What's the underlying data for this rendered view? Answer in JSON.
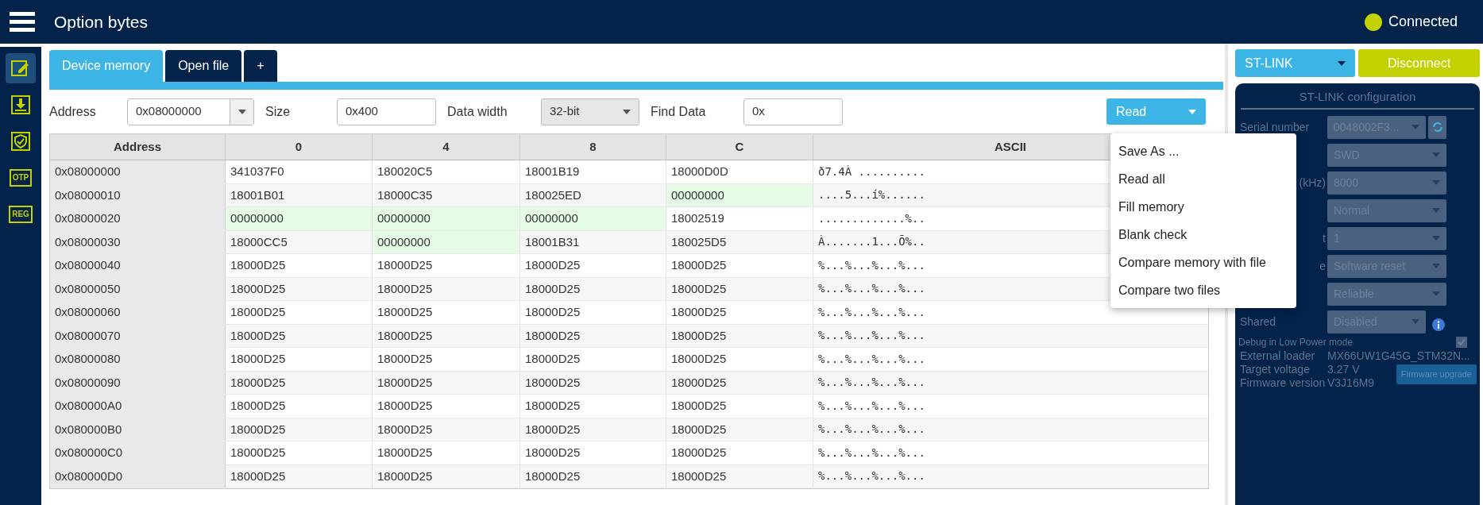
{
  "header": {
    "title": "Option bytes",
    "status": "Connected"
  },
  "sidebar": {
    "items": [
      {
        "kind": "edit",
        "selected": true
      },
      {
        "kind": "download",
        "selected": false
      },
      {
        "kind": "shield",
        "selected": false
      },
      {
        "kind": "text",
        "label": "OTP",
        "selected": false
      },
      {
        "kind": "text",
        "label": "REG",
        "selected": false
      }
    ]
  },
  "tabs": [
    {
      "label": "Device memory",
      "selected": true
    },
    {
      "label": "Open file",
      "selected": false
    },
    {
      "label": "+",
      "selected": false
    }
  ],
  "toolbar": {
    "address_label": "Address",
    "address": "0x08000000",
    "size_label": "Size",
    "size": "0x400",
    "width_label": "Data width",
    "width": "32-bit",
    "find_label": "Find Data",
    "find": "0x",
    "read_button": "Read"
  },
  "table": {
    "columns": [
      "Address",
      "0",
      "4",
      "8",
      "C",
      "ASCII"
    ],
    "rows": [
      {
        "address": "0x08000000",
        "cells": [
          {
            "value": "341037F0",
            "highlighted": false
          },
          {
            "value": "180020C5",
            "highlighted": false
          },
          {
            "value": "18001B19",
            "highlighted": false
          },
          {
            "value": "18000D0D",
            "highlighted": false
          }
        ],
        "ascii": "ð7.4À .........."
      },
      {
        "address": "0x08000010",
        "cells": [
          {
            "value": "18001B01",
            "highlighted": false
          },
          {
            "value": "18000C35",
            "highlighted": false
          },
          {
            "value": "180025ED",
            "highlighted": false
          },
          {
            "value": "00000000",
            "highlighted": true
          }
        ],
        "ascii": "....5...í%......"
      },
      {
        "address": "0x08000020",
        "cells": [
          {
            "value": "00000000",
            "highlighted": true
          },
          {
            "value": "00000000",
            "highlighted": true
          },
          {
            "value": "00000000",
            "highlighted": true
          },
          {
            "value": "18002519",
            "highlighted": false
          }
        ],
        "ascii": ".............%.."
      },
      {
        "address": "0x08000030",
        "cells": [
          {
            "value": "18000CC5",
            "highlighted": false
          },
          {
            "value": "00000000",
            "highlighted": true
          },
          {
            "value": "18001B31",
            "highlighted": false
          },
          {
            "value": "180025D5",
            "highlighted": false
          }
        ],
        "ascii": "À.......1...Õ%.."
      },
      {
        "address": "0x08000040",
        "cells": [
          {
            "value": "18000D25",
            "highlighted": false
          },
          {
            "value": "18000D25",
            "highlighted": false
          },
          {
            "value": "18000D25",
            "highlighted": false
          },
          {
            "value": "18000D25",
            "highlighted": false
          }
        ],
        "ascii": "%...%...%...%..."
      },
      {
        "address": "0x08000050",
        "cells": [
          {
            "value": "18000D25",
            "highlighted": false
          },
          {
            "value": "18000D25",
            "highlighted": false
          },
          {
            "value": "18000D25",
            "highlighted": false
          },
          {
            "value": "18000D25",
            "highlighted": false
          }
        ],
        "ascii": "%...%...%...%..."
      },
      {
        "address": "0x08000060",
        "cells": [
          {
            "value": "18000D25",
            "highlighted": false
          },
          {
            "value": "18000D25",
            "highlighted": false
          },
          {
            "value": "18000D25",
            "highlighted": false
          },
          {
            "value": "18000D25",
            "highlighted": false
          }
        ],
        "ascii": "%...%...%...%..."
      },
      {
        "address": "0x08000070",
        "cells": [
          {
            "value": "18000D25",
            "highlighted": false
          },
          {
            "value": "18000D25",
            "highlighted": false
          },
          {
            "value": "18000D25",
            "highlighted": false
          },
          {
            "value": "18000D25",
            "highlighted": false
          }
        ],
        "ascii": "%...%...%...%..."
      },
      {
        "address": "0x08000080",
        "cells": [
          {
            "value": "18000D25",
            "highlighted": false
          },
          {
            "value": "18000D25",
            "highlighted": false
          },
          {
            "value": "18000D25",
            "highlighted": false
          },
          {
            "value": "18000D25",
            "highlighted": false
          }
        ],
        "ascii": "%...%...%...%..."
      },
      {
        "address": "0x08000090",
        "cells": [
          {
            "value": "18000D25",
            "highlighted": false
          },
          {
            "value": "18000D25",
            "highlighted": false
          },
          {
            "value": "18000D25",
            "highlighted": false
          },
          {
            "value": "18000D25",
            "highlighted": false
          }
        ],
        "ascii": "%...%...%...%..."
      },
      {
        "address": "0x080000A0",
        "cells": [
          {
            "value": "18000D25",
            "highlighted": false
          },
          {
            "value": "18000D25",
            "highlighted": false
          },
          {
            "value": "18000D25",
            "highlighted": false
          },
          {
            "value": "18000D25",
            "highlighted": false
          }
        ],
        "ascii": "%...%...%...%..."
      },
      {
        "address": "0x080000B0",
        "cells": [
          {
            "value": "18000D25",
            "highlighted": false
          },
          {
            "value": "18000D25",
            "highlighted": false
          },
          {
            "value": "18000D25",
            "highlighted": false
          },
          {
            "value": "18000D25",
            "highlighted": false
          }
        ],
        "ascii": "%...%...%...%..."
      },
      {
        "address": "0x080000C0",
        "cells": [
          {
            "value": "18000D25",
            "highlighted": false
          },
          {
            "value": "18000D25",
            "highlighted": false
          },
          {
            "value": "18000D25",
            "highlighted": false
          },
          {
            "value": "18000D25",
            "highlighted": false
          }
        ],
        "ascii": "%...%...%...%..."
      },
      {
        "address": "0x080000D0",
        "cells": [
          {
            "value": "18000D25",
            "highlighted": false
          },
          {
            "value": "18000D25",
            "highlighted": false
          },
          {
            "value": "18000D25",
            "highlighted": false
          },
          {
            "value": "18000D25",
            "highlighted": false
          }
        ],
        "ascii": "%...%...%...%..."
      }
    ]
  },
  "read_menu": {
    "items": [
      "Save As ...",
      "Read all",
      "Fill memory",
      "Blank check",
      "Compare memory with file",
      "Compare two files"
    ]
  },
  "right_panel": {
    "probe": "ST-LINK",
    "disconnect_button": "Disconnect",
    "config": {
      "title": "ST-LINK configuration",
      "disabled": true,
      "fields": [
        {
          "label": "Serial number",
          "value": "0048002F3...",
          "refresh": true
        },
        {
          "value": "SWD",
          "refresh": false
        },
        {
          "label": "(kHz)",
          "value": "8000",
          "refresh": false
        },
        {
          "value": "Normal",
          "refresh": false
        },
        {
          "label": "t",
          "value": "1",
          "refresh": false
        },
        {
          "label": "e",
          "value": "Software reset",
          "refresh": false
        },
        {
          "value": "Reliable",
          "refresh": false
        },
        {
          "label": "Shared",
          "value": "Disabled",
          "refresh": false,
          "info": true
        }
      ],
      "debug_low_power": {
        "label": "Debug in Low Power mode",
        "checked": true
      },
      "info": [
        {
          "label": "External loader",
          "value": "MX66UW1G45G_STM32N..."
        },
        {
          "label": "Target voltage",
          "value": "3.27 V"
        },
        {
          "label": "Firmware version",
          "value": "V3J16M9"
        }
      ],
      "firmware_button": "Firmware upgrade"
    }
  }
}
